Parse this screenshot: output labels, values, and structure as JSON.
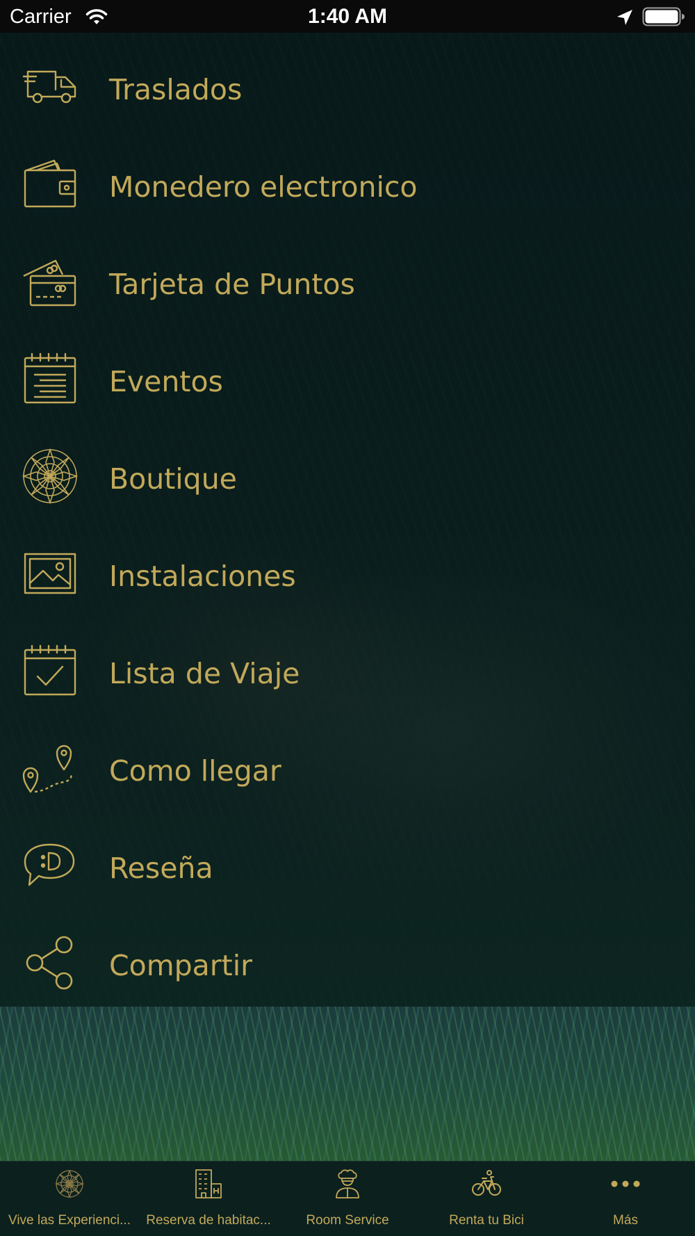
{
  "status_bar": {
    "carrier": "Carrier",
    "time": "1:40 AM"
  },
  "menu": {
    "items": [
      {
        "label": "Traslados",
        "icon": "truck-icon"
      },
      {
        "label": "Monedero electronico",
        "icon": "wallet-icon"
      },
      {
        "label": "Tarjeta de Puntos",
        "icon": "points-card-icon"
      },
      {
        "label": "Eventos",
        "icon": "calendar-list-icon"
      },
      {
        "label": "Boutique",
        "icon": "mandala-icon"
      },
      {
        "label": "Instalaciones",
        "icon": "picture-icon"
      },
      {
        "label": "Lista de Viaje",
        "icon": "calendar-check-icon"
      },
      {
        "label": "Como llegar",
        "icon": "route-pins-icon"
      },
      {
        "label": "Reseña",
        "icon": "chat-smile-icon"
      },
      {
        "label": "Compartir",
        "icon": "share-icon"
      }
    ]
  },
  "tab_bar": {
    "tabs": [
      {
        "label": "Vive las Experienci...",
        "icon": "mandala-icon"
      },
      {
        "label": "Reserva de habitac...",
        "icon": "hotel-icon"
      },
      {
        "label": "Room Service",
        "icon": "chef-icon"
      },
      {
        "label": "Renta tu Bici",
        "icon": "bicycle-icon"
      },
      {
        "label": "Más",
        "icon": "more-dots-icon"
      }
    ]
  },
  "colors": {
    "accent": "#c2a95a",
    "status_bar_bg": "#0a0a0a",
    "panel_bg": "#0b1f1e"
  }
}
